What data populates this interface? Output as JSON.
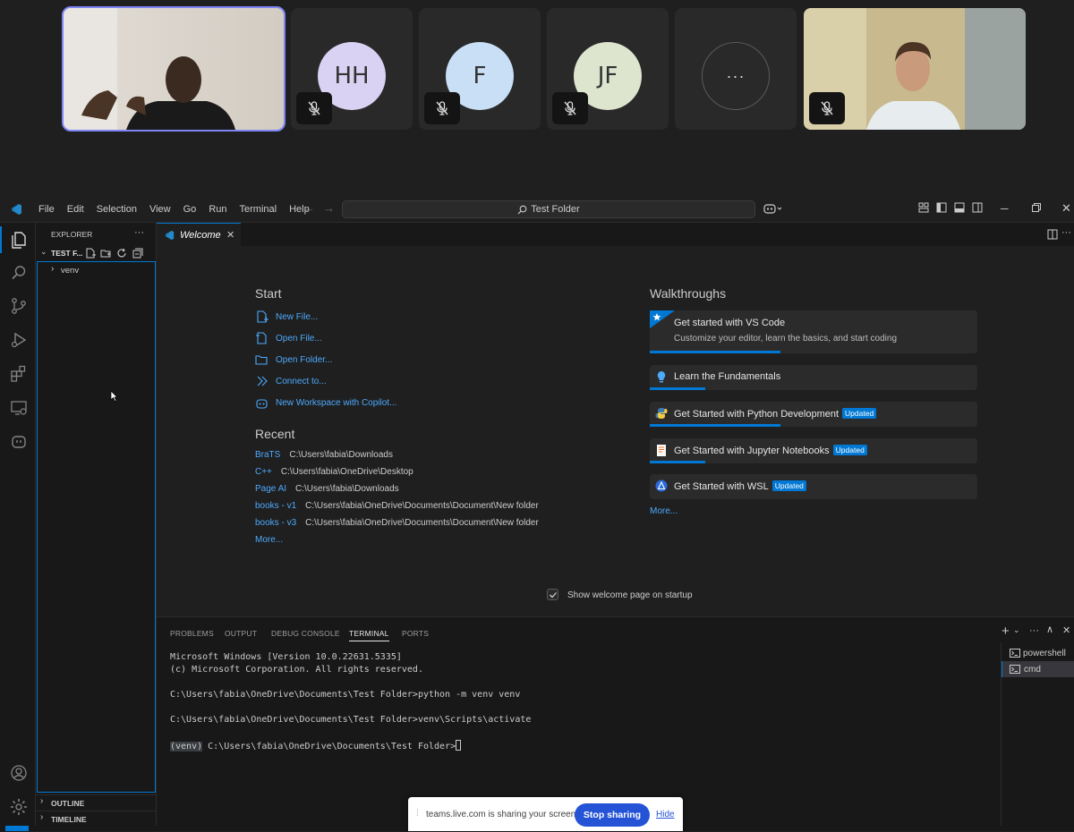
{
  "meeting": {
    "participants": [
      {
        "initials": "HH",
        "color": "#d9d2f2"
      },
      {
        "initials": "F",
        "color": "#c8dff5"
      },
      {
        "initials": "JF",
        "color": "#dde5cf"
      }
    ],
    "overflow_label": "···"
  },
  "menubar": {
    "items": [
      "File",
      "Edit",
      "Selection",
      "View",
      "Go",
      "Run",
      "Terminal",
      "Help"
    ],
    "search_text": "Test Folder"
  },
  "explorer": {
    "title": "EXPLORER",
    "more": "···",
    "folder_name": "TEST F...",
    "tree_items": [
      "venv"
    ],
    "outline": "OUTLINE",
    "timeline": "TIMELINE"
  },
  "editor": {
    "tab_label": "Welcome",
    "start": {
      "title": "Start",
      "links": [
        "New File...",
        "Open File...",
        "Open Folder...",
        "Connect to...",
        "New Workspace with Copilot..."
      ]
    },
    "recent": {
      "title": "Recent",
      "items": [
        {
          "name": "BraTS",
          "path": "C:\\Users\\fabia\\Downloads"
        },
        {
          "name": "C++",
          "path": "C:\\Users\\fabia\\OneDrive\\Desktop"
        },
        {
          "name": "Page AI",
          "path": "C:\\Users\\fabia\\Downloads"
        },
        {
          "name": "books - v1",
          "path": "C:\\Users\\fabia\\OneDrive\\Documents\\Document\\New folder"
        },
        {
          "name": "books - v3",
          "path": "C:\\Users\\fabia\\OneDrive\\Documents\\Document\\New folder"
        }
      ],
      "more": "More..."
    },
    "walkthroughs": {
      "title": "Walkthroughs",
      "items": [
        {
          "title": "Get started with VS Code",
          "subtitle": "Customize your editor, learn the basics, and start coding",
          "badge": "",
          "progress": 0.4
        },
        {
          "title": "Learn the Fundamentals",
          "badge": "",
          "progress": 0.17
        },
        {
          "title": "Get Started with Python Development",
          "badge": "Updated",
          "progress": 0.4
        },
        {
          "title": "Get Started with Jupyter Notebooks",
          "badge": "Updated",
          "progress": 0.17
        },
        {
          "title": "Get Started with WSL",
          "badge": "Updated",
          "progress": 0
        }
      ],
      "more": "More..."
    },
    "show_on_startup": "Show welcome page on startup"
  },
  "panel": {
    "tabs": [
      "PROBLEMS",
      "OUTPUT",
      "DEBUG CONSOLE",
      "TERMINAL",
      "PORTS"
    ],
    "active_tab": "TERMINAL",
    "terminal_lines": [
      "Microsoft Windows [Version 10.0.22631.5335]",
      "(c) Microsoft Corporation. All rights reserved.",
      "C:\\Users\\fabia\\OneDrive\\Documents\\Test Folder>python -m venv venv",
      "C:\\Users\\fabia\\OneDrive\\Documents\\Test Folder>venv\\Scripts\\activate"
    ],
    "prompt_env": "(venv)",
    "prompt_path": " C:\\Users\\fabia\\OneDrive\\Documents\\Test Folder>",
    "terminals": [
      "powershell",
      "cmd"
    ]
  },
  "sharebar": {
    "message": "teams.live.com is sharing your screen.",
    "stop_label": "Stop sharing",
    "hide_label": "Hide"
  },
  "colors": {
    "accent": "#0078d4",
    "link": "#4daafc",
    "speaking_outline": "#7f85f5"
  }
}
